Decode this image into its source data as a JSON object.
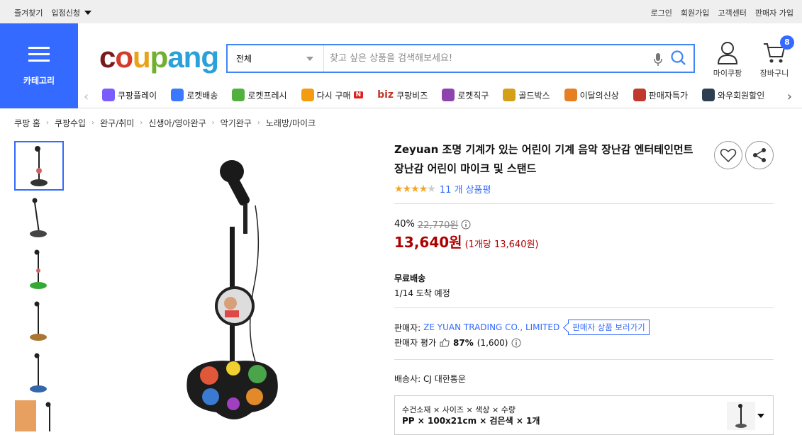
{
  "topbar": {
    "left": [
      "즐겨찾기",
      "입점신청"
    ],
    "right": [
      "로그인",
      "회원가입",
      "고객센터",
      "판매자 가입"
    ]
  },
  "header": {
    "category_label": "카테고리",
    "logo": [
      "c",
      "o",
      "u",
      "p",
      "ang"
    ],
    "search": {
      "scope": "전체",
      "placeholder": "찾고 싶은 상품을 검색해보세요!"
    },
    "mycoupang": "마이쿠팡",
    "cart": "장바구니",
    "cart_count": "8"
  },
  "nav": {
    "items": [
      {
        "label": "쿠팡플레이",
        "icon": "play-icon",
        "color": "#7b5cff"
      },
      {
        "label": "로켓배송",
        "icon": "rocket-icon",
        "color": "#3c78ff"
      },
      {
        "label": "로켓프레시",
        "icon": "rocket-fresh-icon",
        "color": "#52b13e"
      },
      {
        "label": "다시 구매",
        "icon": "rebuy-icon",
        "color": "#f39c12",
        "badge": "N"
      },
      {
        "label": "쿠팡비즈",
        "icon": "biz-icon",
        "color": "#c0392b",
        "prefix": "biz"
      },
      {
        "label": "로켓직구",
        "icon": "global-rocket-icon",
        "color": "#8e44ad"
      },
      {
        "label": "골드박스",
        "icon": "goldbox-icon",
        "color": "#d4a017"
      },
      {
        "label": "이달의신상",
        "icon": "new-icon",
        "color": "#e67e22"
      },
      {
        "label": "판매자특가",
        "icon": "seller-deal-icon",
        "color": "#c0392b"
      },
      {
        "label": "와우회원할인",
        "icon": "wow-icon",
        "color": "#2c3e50"
      }
    ]
  },
  "breadcrumb": [
    "쿠팡 홈",
    "쿠팡수입",
    "완구/취미",
    "신생아/영아완구",
    "악기완구",
    "노래방/마이크"
  ],
  "product": {
    "title": "Zeyuan 조명 기계가 있는 어린이 기계 음악 장난감 엔터테인먼트 장난감 어린이 마이크 및 스탠드",
    "rating_stars": 4,
    "review_text": "11 개 상품평",
    "discount_rate": "40%",
    "original_price": "22,770원",
    "price": "13,640원",
    "unit_price": "(1개당 13,640원)",
    "shipping_title": "무료배송",
    "shipping_eta": "1/14 도착 예정",
    "seller_label": "판매자:",
    "seller_name": "ZE YUAN TRADING CO., LIMITED",
    "seller_link": "판매자 상품 보러가기",
    "seller_rating_label": "판매자 평가",
    "seller_rating_pct": "87%",
    "seller_rating_count": "(1,600)",
    "carrier": "배송사:  CJ 대한통운",
    "option_line1": "수건소재 × 사이즈 × 색상 × 수량",
    "option_line2": "PP × 100x21cm × 검은색 × 1개"
  },
  "colors": {
    "brand_blue": "#346aff",
    "price_red": "#ae0000",
    "star": "#f5a623"
  }
}
